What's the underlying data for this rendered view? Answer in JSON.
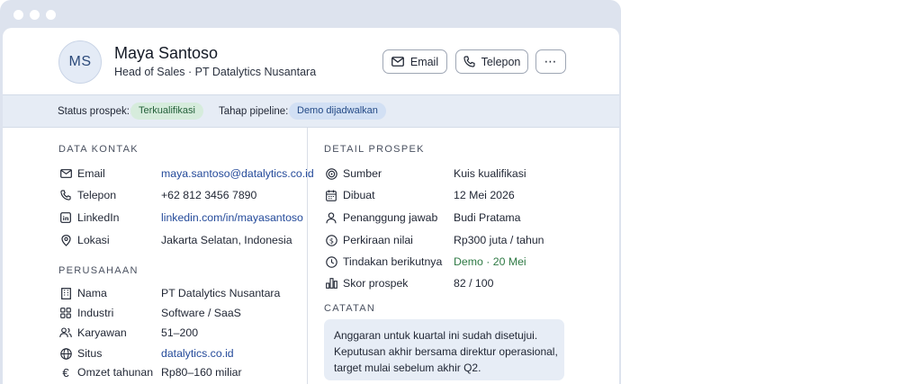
{
  "window": {
    "accent": "#244a86"
  },
  "contact": {
    "initials": "MS",
    "name": "Maya Santoso",
    "role": "Head of Sales · PT Datalytics Nusantara"
  },
  "actions": {
    "email": "Email",
    "phone": "Telepon",
    "more": "⋯"
  },
  "status": {
    "prospect_label": "Status prospek:",
    "prospect_value": "Terkualifikasi",
    "pipeline_label": "Tahap pipeline:",
    "pipeline_value": "Demo dijadwalkan"
  },
  "data_kontak": {
    "title": "DATA KONTAK",
    "rows": [
      {
        "icon": "mail-icon",
        "label": "Email",
        "value": "maya.santoso@datalytics.co.id"
      },
      {
        "icon": "phone-icon",
        "label": "Telepon",
        "value": "+62 812 3456 7890"
      },
      {
        "icon": "linkedin-icon",
        "label": "LinkedIn",
        "value": "linkedin.com/in/mayasantoso"
      },
      {
        "icon": "location-pin-icon",
        "label": "Lokasi",
        "value": "Jakarta Selatan, Indonesia"
      }
    ]
  },
  "perusahaan": {
    "title": "PERUSAHAAN",
    "rows": [
      {
        "icon": "building-icon",
        "label": "Nama",
        "value": "PT Datalytics Nusantara"
      },
      {
        "icon": "grid-icon",
        "label": "Industri",
        "value": "Software / SaaS"
      },
      {
        "icon": "users-icon",
        "label": "Karyawan",
        "value": "51–200"
      },
      {
        "icon": "globe-icon",
        "label": "Situs",
        "value": "datalytics.co.id"
      },
      {
        "icon": "euro-icon",
        "label": "Omzet tahunan",
        "value": "Rp80–160 miliar"
      }
    ]
  },
  "detail_prospek": {
    "title": "DETAIL PROSPEK",
    "rows": [
      {
        "icon": "target-icon",
        "label": "Sumber",
        "value": "Kuis kualifikasi"
      },
      {
        "icon": "calendar-icon",
        "label": "Dibuat",
        "value": "12 Mei 2026"
      },
      {
        "icon": "user-icon",
        "label": "Penanggung jawab",
        "value": "Budi Pratama"
      },
      {
        "icon": "dollar-icon",
        "label": "Perkiraan nilai",
        "value": "Rp300 juta / tahun"
      },
      {
        "icon": "clock-icon",
        "label": "Tindakan berikutnya",
        "value": "Demo · 20 Mei"
      },
      {
        "icon": "bar-chart-icon",
        "label": "Skor prospek",
        "value": "82 / 100"
      }
    ]
  },
  "catatan": {
    "title": "CATATAN",
    "lines": [
      "Anggaran untuk kuartal ini sudah disetujui.",
      "Keputusan akhir bersama direktur operasional,",
      "target mulai sebelum akhir Q2."
    ]
  }
}
